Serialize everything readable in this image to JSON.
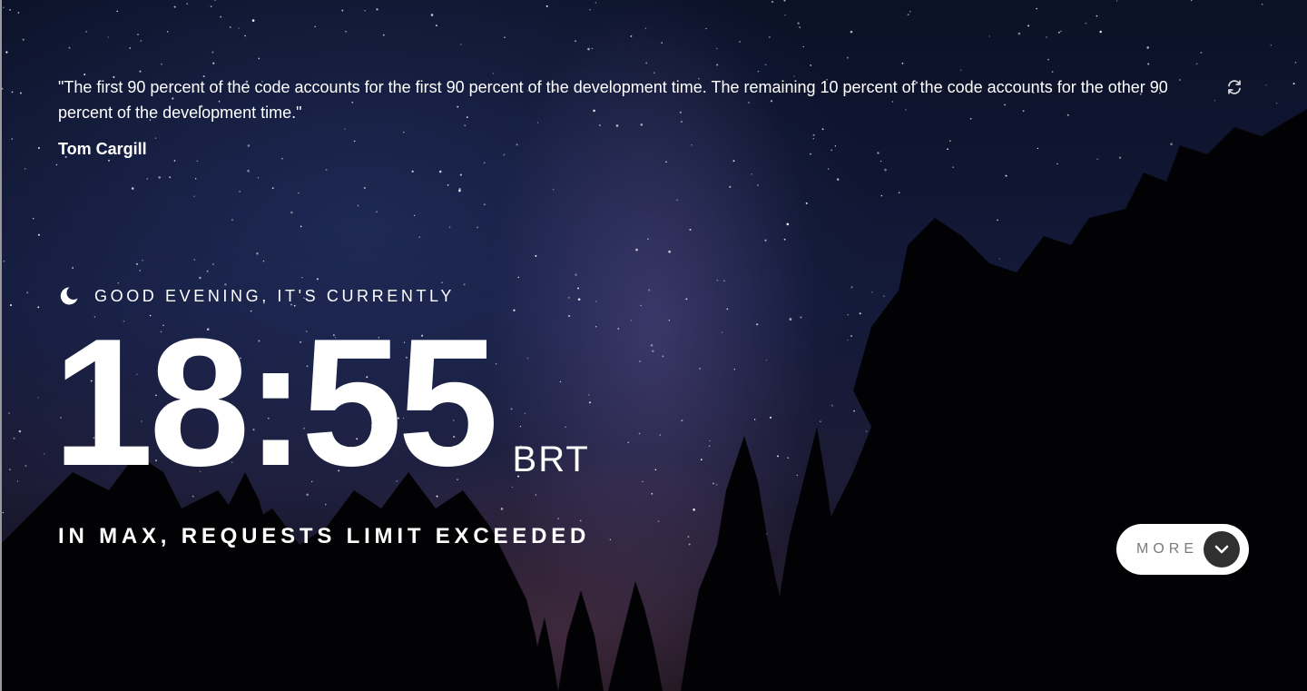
{
  "quote": {
    "text": "\"The first 90 percent of the code accounts for the first 90 percent of the development time. The remaining 10 percent of the code accounts for the other 90 percent of the development time.\"",
    "author": "Tom Cargill",
    "refresh_icon": "refresh-icon"
  },
  "clock": {
    "greeting": "GOOD EVENING, IT'S CURRENTLY",
    "greeting_icon": "moon-icon",
    "time": "18:55",
    "timezone": "BRT",
    "location": "IN MAX, REQUESTS LIMIT EXCEEDED"
  },
  "more_button": {
    "label": "MORE",
    "icon": "chevron-down-icon",
    "background": "#ffffff",
    "icon_background": "#303030",
    "label_color": "#7a7a7a"
  },
  "background": {
    "description_icon": "night-sky-forest-image",
    "sky_color": "#141a3a"
  }
}
